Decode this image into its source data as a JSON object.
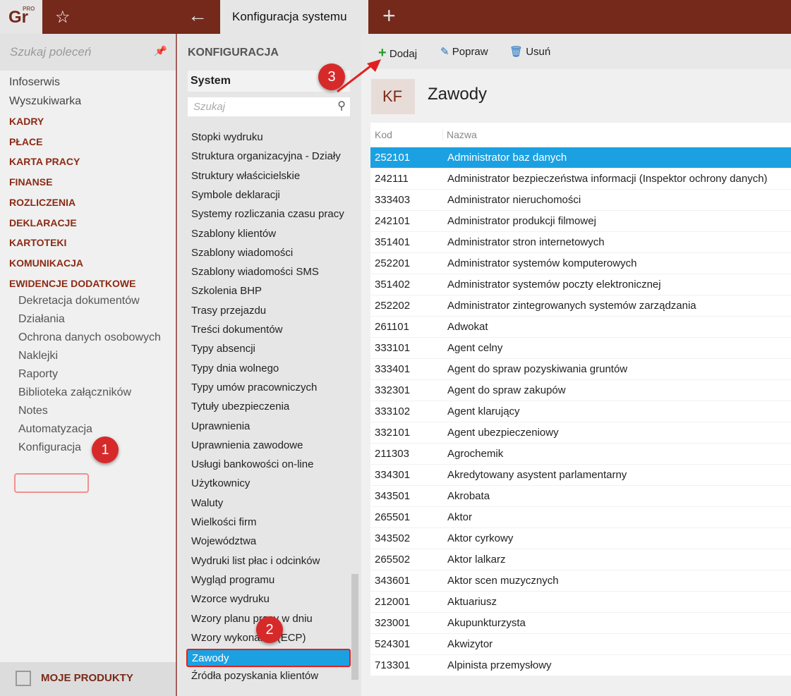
{
  "topbar": {
    "logo": "Gr",
    "logo_sup": "PRO",
    "tab": "Konfiguracja systemu"
  },
  "left": {
    "search_placeholder": "Szukaj poleceń",
    "items": [
      "Infoserwis",
      "Wyszukiwarka"
    ],
    "headers": [
      "KADRY",
      "PŁACE",
      "KARTA PRACY",
      "FINANSE",
      "ROZLICZENIA",
      "DEKLARACJE",
      "KARTOTEKI",
      "KOMUNIKACJA",
      "EWIDENCJE DODATKOWE"
    ],
    "subitems": [
      "Dekretacja dokumentów",
      "Działania",
      "Ochrona danych osobowych",
      "Naklejki",
      "Raporty",
      "Biblioteka załączników",
      "Notes",
      "Automatyzacja",
      "Konfiguracja"
    ],
    "bottom": "MOJE PRODUKTY"
  },
  "middle": {
    "title": "KONFIGURACJA",
    "select": "System",
    "search_placeholder": "Szukaj",
    "items": [
      "Stopki wydruku",
      "Struktura organizacyjna - Działy",
      "Struktury właścicielskie",
      "Symbole deklaracji",
      "Systemy rozliczania czasu pracy",
      "Szablony klientów",
      "Szablony wiadomości",
      "Szablony wiadomości SMS",
      "Szkolenia BHP",
      "Trasy przejazdu",
      "Treści dokumentów",
      "Typy absencji",
      "Typy dnia wolnego",
      "Typy umów pracowniczych",
      "Tytuły ubezpieczenia",
      "Uprawnienia",
      "Uprawnienia zawodowe",
      "Usługi bankowości on-line",
      "Użytkownicy",
      "Waluty",
      "Wielkości firm",
      "Województwa",
      "Wydruki list płac i odcinków",
      "Wygląd programu",
      "Wzorce wydruku",
      "Wzory planu pracy w dniu",
      "Wzory wykonania (ECP)",
      "Zawody",
      "Źródła pozyskania klientów"
    ],
    "selected": "Zawody"
  },
  "toolbar": {
    "add": "Dodaj",
    "edit": "Popraw",
    "delete": "Usuń"
  },
  "content": {
    "badge": "KF",
    "title": "Zawody",
    "columns": [
      "Kod",
      "Nazwa"
    ],
    "rows": [
      [
        "252101",
        "Administrator baz danych"
      ],
      [
        "242111",
        "Administrator bezpieczeństwa informacji (Inspektor ochrony danych)"
      ],
      [
        "333403",
        "Administrator nieruchomości"
      ],
      [
        "242101",
        "Administrator produkcji filmowej"
      ],
      [
        "351401",
        "Administrator stron internetowych"
      ],
      [
        "252201",
        "Administrator systemów komputerowych"
      ],
      [
        "351402",
        "Administrator systemów poczty elektronicznej"
      ],
      [
        "252202",
        "Administrator zintegrowanych systemów zarządzania"
      ],
      [
        "261101",
        "Adwokat"
      ],
      [
        "333101",
        "Agent celny"
      ],
      [
        "333401",
        "Agent do spraw pozyskiwania gruntów"
      ],
      [
        "332301",
        "Agent do spraw zakupów"
      ],
      [
        "333102",
        "Agent klarujący"
      ],
      [
        "332101",
        "Agent ubezpieczeniowy"
      ],
      [
        "211303",
        "Agrochemik"
      ],
      [
        "334301",
        "Akredytowany asystent parlamentarny"
      ],
      [
        "343501",
        "Akrobata"
      ],
      [
        "265501",
        "Aktor"
      ],
      [
        "343502",
        "Aktor cyrkowy"
      ],
      [
        "265502",
        "Aktor lalkarz"
      ],
      [
        "343601",
        "Aktor scen muzycznych"
      ],
      [
        "212001",
        "Aktuariusz"
      ],
      [
        "323001",
        "Akupunkturzysta"
      ],
      [
        "524301",
        "Akwizytor"
      ],
      [
        "713301",
        "Alpinista przemysłowy"
      ]
    ]
  },
  "annotations": [
    "1",
    "2",
    "3"
  ],
  "colors": {
    "brand": "#74291a",
    "selection": "#1ba1e2",
    "badge": "#d62a2a",
    "add": "#2a9a2a",
    "edit": "#1b6fc2"
  }
}
